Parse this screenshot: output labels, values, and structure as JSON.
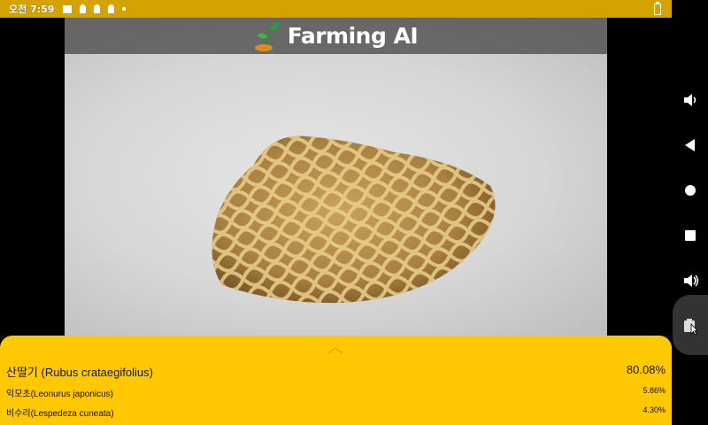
{
  "status_bar": {
    "time": "오전 7:59",
    "icons": [
      "image-icon",
      "pin-icon",
      "pin-icon",
      "pin-icon",
      "dot-icon"
    ],
    "battery_icon": "battery-icon"
  },
  "app": {
    "title": "Farming AI",
    "logo_icon": "sprout-icon"
  },
  "nav": {
    "buttons": [
      "volume-down-icon",
      "back-icon",
      "home-icon",
      "recents-icon",
      "volume-up-icon",
      "screenshot-icon"
    ]
  },
  "results": {
    "expand_icon": "chevron-up-icon",
    "top": {
      "name": "산딸기 (Rubus crataegifolius)",
      "confidence": "80.08%"
    },
    "others": [
      {
        "name": "익모초(Leonurus japonicus)",
        "confidence": "5.86%"
      },
      {
        "name": "비수리(Lespedeza cuneata)",
        "confidence": "4.30%"
      }
    ]
  },
  "colors": {
    "status_bar": "#d4a300",
    "panel": "#ffc800",
    "header_overlay": "#505050"
  }
}
